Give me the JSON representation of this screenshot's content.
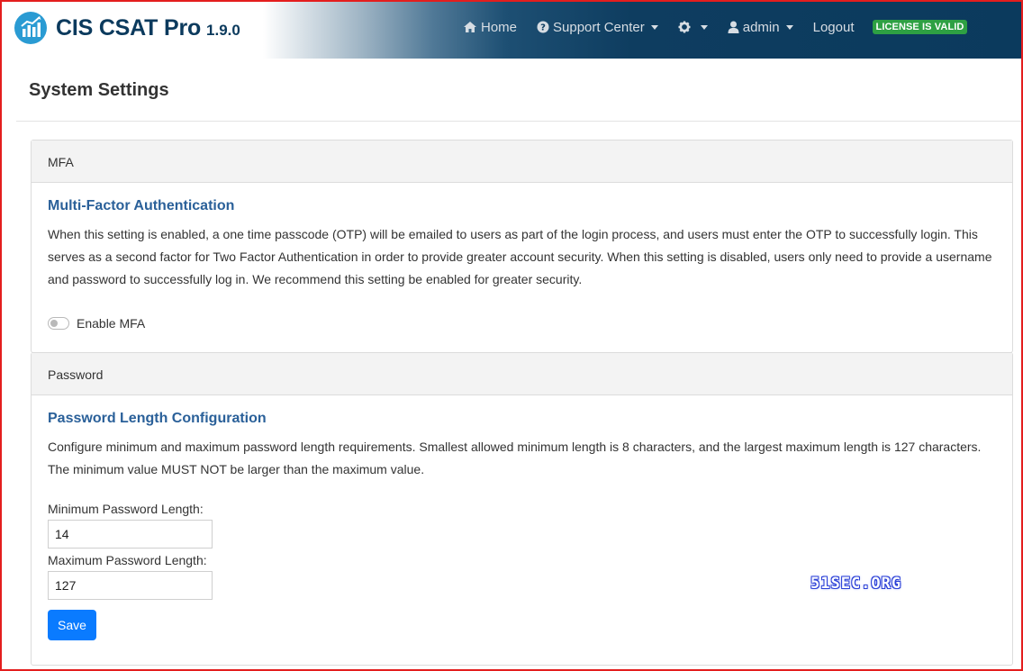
{
  "app": {
    "name": "CIS CSAT Pro",
    "version": "1.9.0",
    "logo_icon": "chart-logo-icon",
    "accent_color": "#2a9bd3",
    "brand_color": "#0b3a5d"
  },
  "nav": {
    "home": {
      "label": "Home",
      "icon": "home-icon"
    },
    "support": {
      "label": "Support Center",
      "icon": "question-circle-icon"
    },
    "settings": {
      "icon": "gear-icon"
    },
    "user": {
      "label": "admin",
      "icon": "user-icon"
    },
    "logout": {
      "label": "Logout"
    },
    "license_badge": {
      "label": "LICENSE IS VALID",
      "color": "#2ea043"
    }
  },
  "page": {
    "title": "System Settings"
  },
  "mfa": {
    "header": "MFA",
    "title": "Multi-Factor Authentication",
    "description": "When this setting is enabled, a one time passcode (OTP) will be emailed to users as part of the login process, and users must enter the OTP to successfully login. This serves as a second factor for Two Factor Authentication in order to provide greater account security. When this setting is disabled, users only need to provide a username and password to successfully log in. We recommend this setting be enabled for greater security.",
    "toggle_label": "Enable MFA",
    "enabled": false
  },
  "password": {
    "header": "Password",
    "title": "Password Length Configuration",
    "description": "Configure minimum and maximum password length requirements. Smallest allowed minimum length is 8 characters, and the largest maximum length is 127 characters. The minimum value MUST NOT be larger than the maximum value.",
    "min_label": "Minimum Password Length:",
    "min_value": "14",
    "max_label": "Maximum Password Length:",
    "max_value": "127",
    "save_label": "Save",
    "save_color": "#0a7bff"
  },
  "watermark": "51SEC.ORG"
}
